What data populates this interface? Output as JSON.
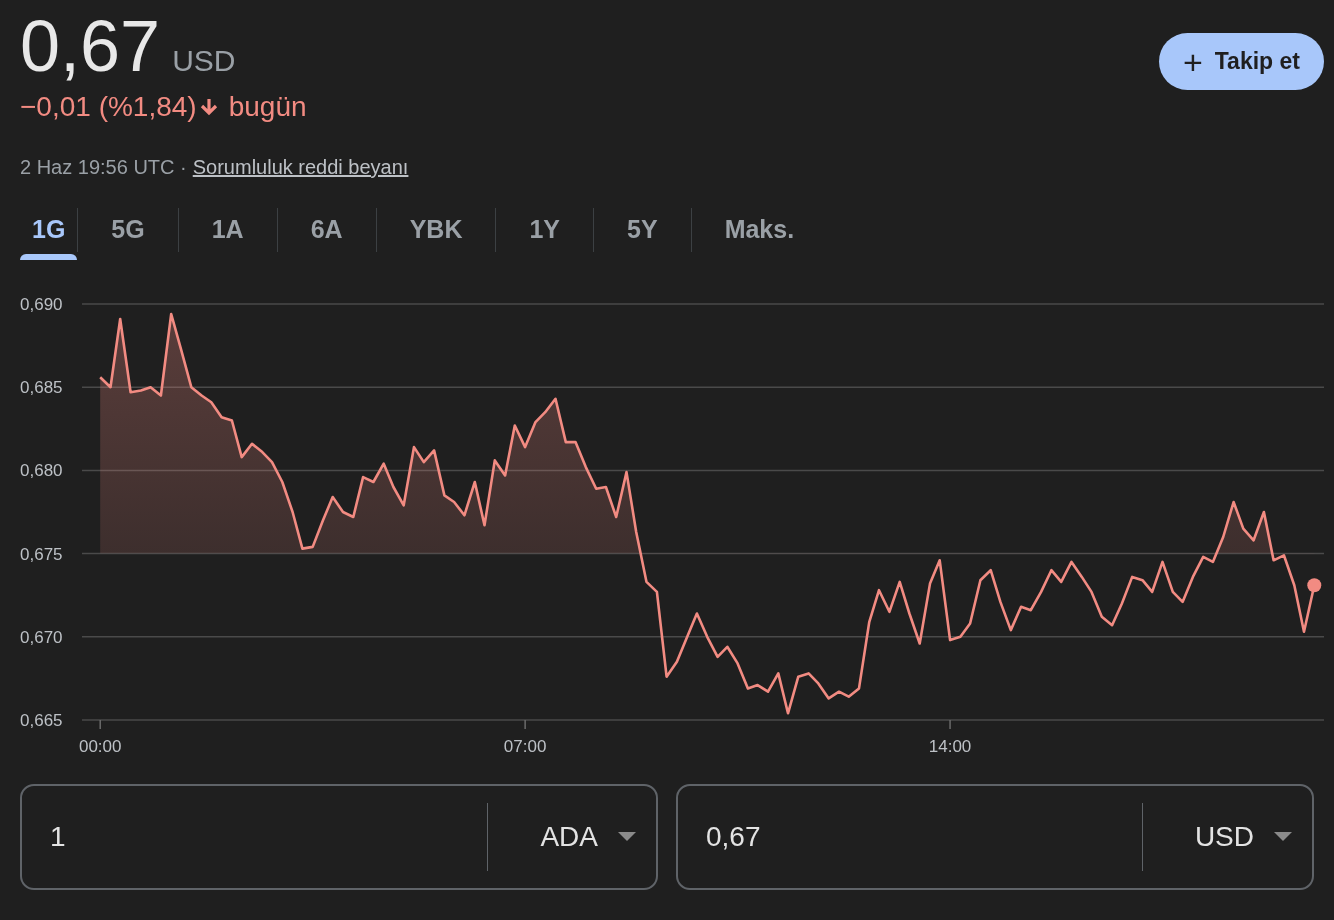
{
  "quote": {
    "price": "0,67",
    "currency": "USD",
    "change": "−0,01 (%1,84)",
    "falling": true,
    "period": "bugün",
    "timestamp": "2 Haz 19:56 UTC ·",
    "disclaimer_link": "Sorumluluk reddi beyanı"
  },
  "follow_button": {
    "icon": "+",
    "label": "Takip et"
  },
  "range_tabs": [
    {
      "label": "1G",
      "selected": true
    },
    {
      "label": "5G",
      "selected": false
    },
    {
      "label": "1A",
      "selected": false
    },
    {
      "label": "6A",
      "selected": false
    },
    {
      "label": "YBK",
      "selected": false
    },
    {
      "label": "1Y",
      "selected": false
    },
    {
      "label": "5Y",
      "selected": false
    },
    {
      "label": "Maks.",
      "selected": false
    }
  ],
  "chart": {
    "chart_data": {
      "type": "line",
      "grid": true,
      "x": [
        0,
        0.17,
        0.33,
        0.5,
        0.67,
        0.83,
        1,
        1.17,
        1.33,
        1.5,
        1.67,
        1.83,
        2,
        2.17,
        2.33,
        2.5,
        2.67,
        2.83,
        3,
        3.17,
        3.33,
        3.5,
        3.67,
        3.83,
        4,
        4.17,
        4.33,
        4.5,
        4.67,
        4.83,
        5,
        5.17,
        5.33,
        5.5,
        5.67,
        5.83,
        6,
        6.17,
        6.33,
        6.5,
        6.67,
        6.83,
        7,
        7.17,
        7.33,
        7.5,
        7.67,
        7.83,
        8,
        8.17,
        8.33,
        8.5,
        8.67,
        8.83,
        9,
        9.17,
        9.33,
        9.5,
        9.67,
        9.83,
        10,
        10.17,
        10.33,
        10.5,
        10.67,
        10.83,
        11,
        11.17,
        11.33,
        11.5,
        11.67,
        11.83,
        12,
        12.17,
        12.33,
        12.5,
        12.67,
        12.83,
        13,
        13.17,
        13.33,
        13.5,
        13.67,
        13.83,
        14,
        14.17,
        14.33,
        14.5,
        14.67,
        14.83,
        15,
        15.17,
        15.33,
        15.5,
        15.67,
        15.83,
        16,
        16.17,
        16.33,
        16.5,
        16.67,
        16.83,
        17,
        17.17,
        17.33,
        17.5,
        17.67,
        17.83,
        18,
        18.17,
        18.33,
        18.5,
        18.67,
        18.83,
        19,
        19.17,
        19.33,
        19.5,
        19.67,
        19.83,
        20
      ],
      "xlim": [
        -0.3,
        20.16
      ],
      "ylim": [
        0.665,
        0.69
      ],
      "xticks": [
        {
          "value": 0,
          "label": "00:00"
        },
        {
          "value": 7,
          "label": "07:00"
        },
        {
          "value": 14,
          "label": "14:00"
        }
      ],
      "yticks": [
        {
          "value": 0.69,
          "label": "0,690"
        },
        {
          "value": 0.685,
          "label": "0,685"
        },
        {
          "value": 0.68,
          "label": "0,680"
        },
        {
          "value": 0.675,
          "label": "0,675"
        },
        {
          "value": 0.67,
          "label": "0,670"
        },
        {
          "value": 0.665,
          "label": "0,665"
        }
      ],
      "series": [
        {
          "color": "#f28b82",
          "values": [
            0.6856,
            0.685,
            0.6891,
            0.6847,
            0.6848,
            0.685,
            0.6845,
            0.6894,
            0.6873,
            0.685,
            0.6845,
            0.6841,
            0.6832,
            0.683,
            0.6808,
            0.6816,
            0.6811,
            0.6805,
            0.6793,
            0.6775,
            0.6753,
            0.6754,
            0.677,
            0.6784,
            0.6775,
            0.6772,
            0.6796,
            0.6793,
            0.6804,
            0.679,
            0.6779,
            0.6814,
            0.6805,
            0.6812,
            0.6785,
            0.6781,
            0.6773,
            0.6793,
            0.6767,
            0.6806,
            0.6797,
            0.6827,
            0.6814,
            0.6829,
            0.6835,
            0.6843,
            0.6817,
            0.6817,
            0.6802,
            0.6789,
            0.679,
            0.6772,
            0.6799,
            0.6763,
            0.6733,
            0.6727,
            0.6676,
            0.6685,
            0.67,
            0.6714,
            0.67,
            0.6688,
            0.6694,
            0.6684,
            0.6669,
            0.6671,
            0.6667,
            0.6678,
            0.6654,
            0.6676,
            0.6678,
            0.6672,
            0.6663,
            0.6667,
            0.6664,
            0.6669,
            0.6709,
            0.6728,
            0.6715,
            0.6733,
            0.6714,
            0.6696,
            0.6732,
            0.6746,
            0.6698,
            0.67,
            0.6708,
            0.6734,
            0.674,
            0.6721,
            0.6704,
            0.6718,
            0.6716,
            0.6727,
            0.674,
            0.6733,
            0.6745,
            0.6736,
            0.6727,
            0.6712,
            0.6707,
            0.672,
            0.6736,
            0.6734,
            0.6727,
            0.6745,
            0.6727,
            0.6721,
            0.6736,
            0.6748,
            0.6745,
            0.676,
            0.6781,
            0.6765,
            0.6758,
            0.6775,
            0.6746,
            0.6749,
            0.6731,
            0.6703,
            0.6731
          ]
        }
      ]
    }
  },
  "converter": [
    {
      "amount": "1",
      "currency": "ADA"
    },
    {
      "amount": "0,67",
      "currency": "USD"
    }
  ]
}
